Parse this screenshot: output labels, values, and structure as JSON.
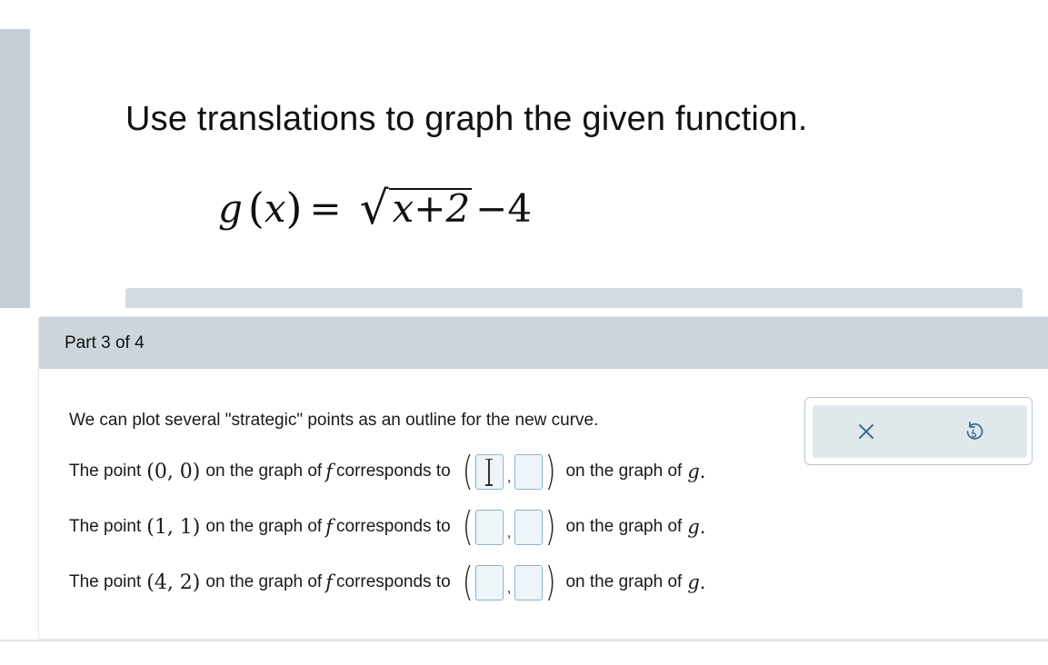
{
  "question": {
    "title": "Use translations to graph the given function.",
    "formula": {
      "func_name": "g",
      "variable": "x",
      "equals": "=",
      "radicand": "x+2",
      "tail": "−4"
    }
  },
  "part": {
    "label": "Part 3 of 4",
    "intro": "We can plot several \"strategic\" points as an outline for the new curve.",
    "rows": [
      {
        "prefix": "The point",
        "point": "(0, 0)",
        "middle": "on the graph of",
        "f": "f",
        "corresponds": "corresponds to",
        "suffix": "on the graph of",
        "g": "g.",
        "x_value": "",
        "y_value": ""
      },
      {
        "prefix": "The point",
        "point": "(1, 1)",
        "middle": "on the graph of",
        "f": "f",
        "corresponds": "corresponds to",
        "suffix": "on the graph of",
        "g": "g.",
        "x_value": "",
        "y_value": ""
      },
      {
        "prefix": "The point",
        "point": "(4, 2)",
        "middle": "on the graph of",
        "f": "f",
        "corresponds": "corresponds to",
        "suffix": "on the graph of",
        "g": "g.",
        "x_value": "",
        "y_value": ""
      }
    ]
  },
  "toolbox": {
    "clear_icon": "close-icon",
    "undo_icon": "undo-icon",
    "icon_color": "#3b6f8f"
  },
  "colors": {
    "header_bg": "#cdd6dc",
    "input_border": "#8bb3c9",
    "input_bg": "#eef5f9"
  }
}
